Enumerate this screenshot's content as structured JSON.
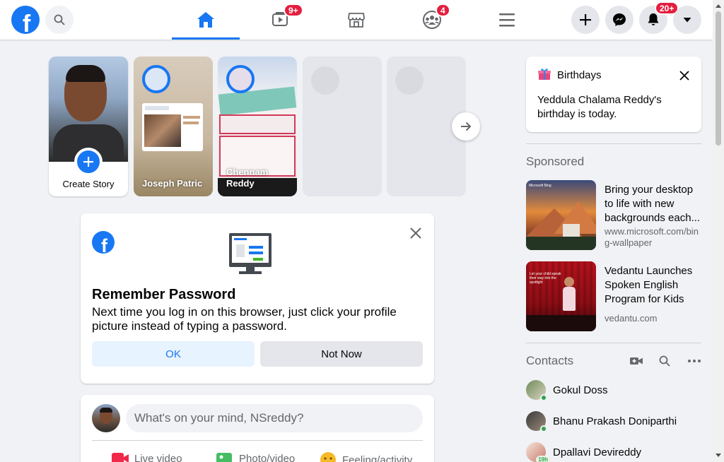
{
  "nav": {
    "watch_badge": "9+",
    "groups_badge": "4",
    "notifications_badge": "20+"
  },
  "stories": {
    "create_label": "Create Story",
    "items": [
      {
        "name": "Joseph Patric"
      },
      {
        "name": "Chennam Reddy"
      }
    ]
  },
  "remember_password": {
    "title": "Remember Password",
    "text": "Next time you log in on this browser, just click your profile picture instead of typing a password.",
    "ok_label": "OK",
    "not_now_label": "Not Now"
  },
  "composer": {
    "placeholder": "What's on your mind, NSreddy?",
    "actions": [
      "Live video",
      "Photo/video",
      "Feeling/activity"
    ]
  },
  "birthdays": {
    "title": "Birthdays",
    "text": "Yeddula Chalama Reddy's birthday is today."
  },
  "sponsored": {
    "title": "Sponsored",
    "ads": [
      {
        "title": "Bring your desktop to life with new backgrounds each...",
        "url": "www.microsoft.com/bing-wallpaper",
        "img_label": "Microsoft Bing"
      },
      {
        "title": "Vedantu Launches Spoken English Program for Kids",
        "url": "vedantu.com",
        "img_label": "Let your child speak their way into the spotlight"
      }
    ]
  },
  "contacts": {
    "title": "Contacts",
    "items": [
      {
        "name": "Gokul Doss"
      },
      {
        "name": "Bhanu Prakash Doniparthi"
      },
      {
        "name": "Dpallavi Devireddy",
        "badge": "19h"
      }
    ]
  },
  "colors": {
    "brand": "#1877f2",
    "badge": "#e41e3f",
    "background": "#f0f2f5"
  }
}
